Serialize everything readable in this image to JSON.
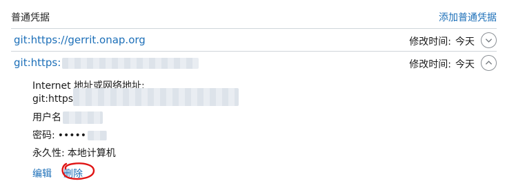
{
  "header": {
    "section_title": "普通凭据",
    "add_link": "添加普通凭据"
  },
  "credentials": [
    {
      "name": "git:https://gerrit.onap.org",
      "modified_label": "修改时间:",
      "modified_value": "今天",
      "expanded": false
    },
    {
      "name": "git:https:",
      "modified_label": "修改时间:",
      "modified_value": "今天",
      "expanded": true
    }
  ],
  "details": {
    "address_label": "Internet 地址或网络地址:",
    "address_value": "git:https",
    "username_label": "用户名",
    "password_label": "密码:",
    "password_value": "•••••",
    "persistence_label": "永久性:",
    "persistence_value": "本地计算机"
  },
  "actions": {
    "edit": "编辑",
    "delete": "删除"
  },
  "colors": {
    "link": "#1c6fb8",
    "divider": "#cfd5da",
    "annotation": "#e01414"
  }
}
